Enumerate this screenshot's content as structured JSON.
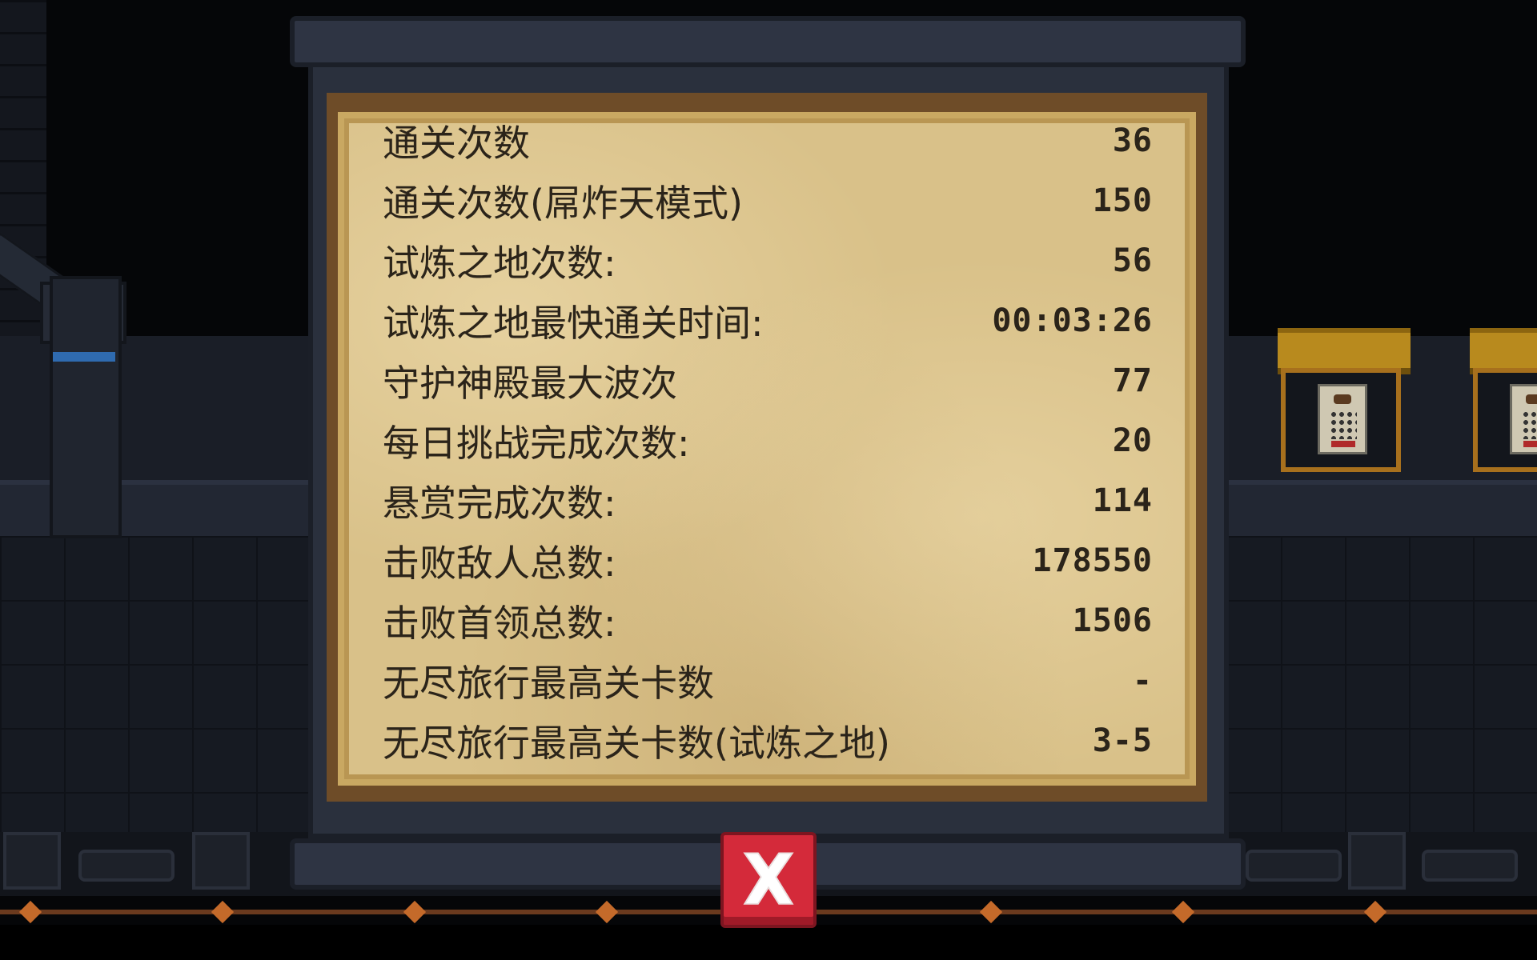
{
  "stats": [
    {
      "label": "通关次数",
      "value": "36"
    },
    {
      "label": "通关次数(屌炸天模式)",
      "value": "150"
    },
    {
      "label": "试炼之地次数:",
      "value": "56"
    },
    {
      "label": "试炼之地最快通关时间:",
      "value": "00:03:26"
    },
    {
      "label": "守护神殿最大波次",
      "value": "77"
    },
    {
      "label": "每日挑战完成次数:",
      "value": "20"
    },
    {
      "label": "悬赏完成次数:",
      "value": "114"
    },
    {
      "label": "击败敌人总数:",
      "value": "178550"
    },
    {
      "label": "击败首领总数:",
      "value": "1506"
    },
    {
      "label": "无尽旅行最高关卡数",
      "value": "-"
    },
    {
      "label": "无尽旅行最高关卡数(试炼之地)",
      "value": "3-5"
    }
  ],
  "close_button": {
    "icon": "close-icon"
  },
  "colors": {
    "parchment": "#d9c189",
    "text": "#2b241a",
    "close_button": "#d42a3a",
    "panel": "#2a303d"
  }
}
